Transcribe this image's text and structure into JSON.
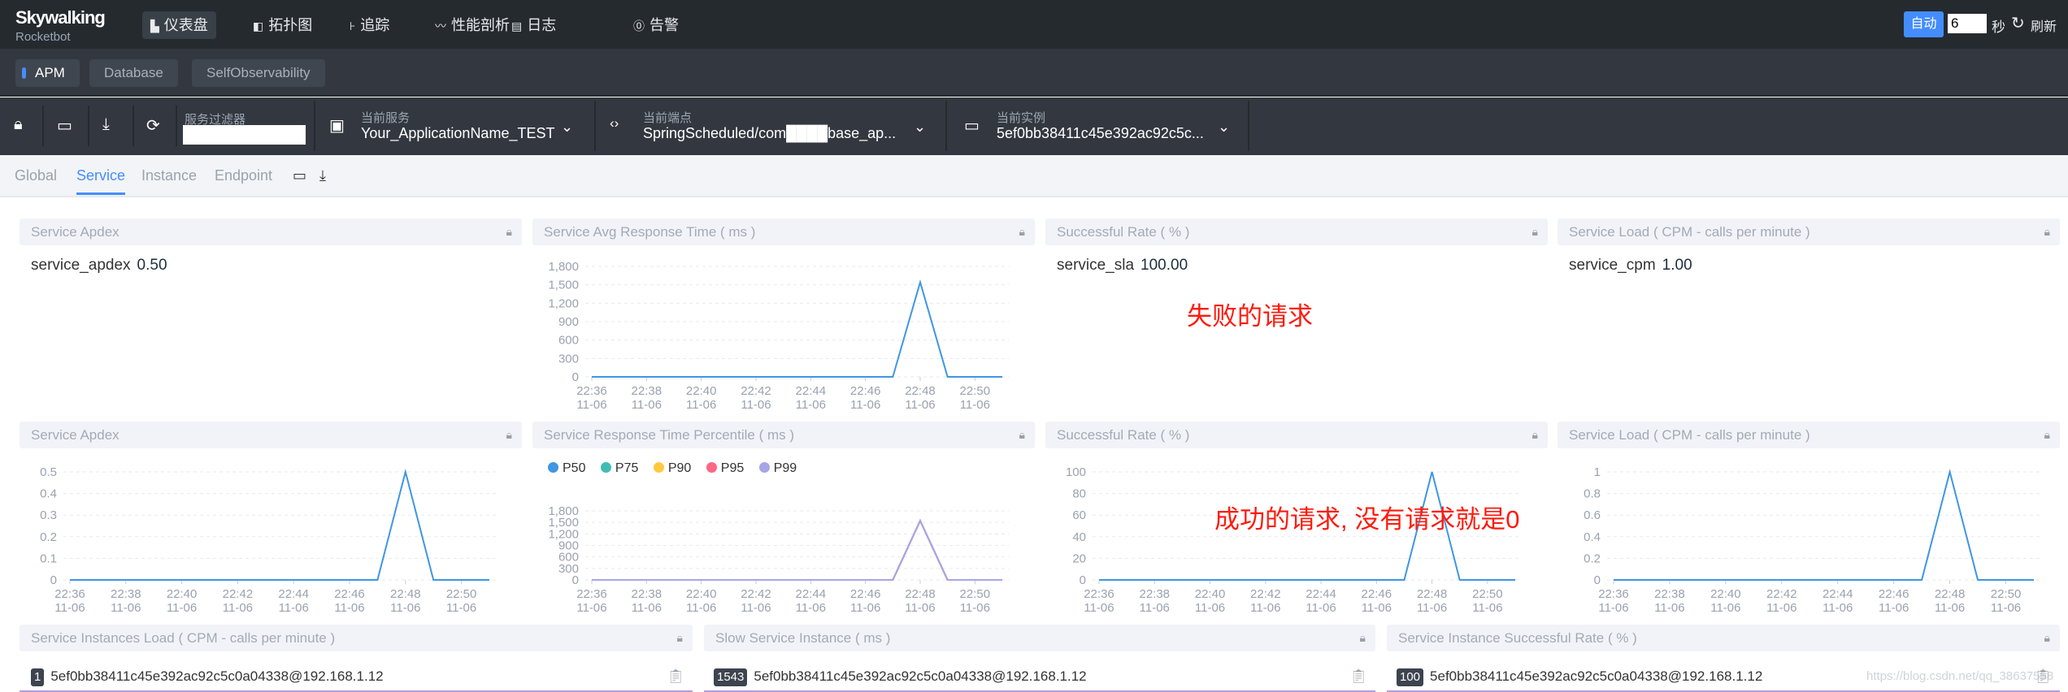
{
  "brand": {
    "name": "Skywalking",
    "sub": "Rocketbot"
  },
  "nav": [
    {
      "label": "仪表盘",
      "icon": "dashboard-icon"
    },
    {
      "label": "拓扑图",
      "icon": "topology-icon"
    },
    {
      "label": "追踪",
      "icon": "trace-icon"
    },
    {
      "label": "性能剖析",
      "icon": "profile-icon"
    },
    {
      "label": "日志",
      "icon": "log-icon"
    },
    {
      "label": "告警",
      "icon": "alarm-icon"
    }
  ],
  "refresh": {
    "auto": "自动",
    "interval": "6",
    "unit": "秒",
    "label": "刷新"
  },
  "groups": [
    "APM",
    "Database",
    "SelfObservability"
  ],
  "toolbar": {
    "filter_label": "服务过滤器",
    "filter_value": "",
    "service_label": "当前服务",
    "service": "Your_ApplicationName_TEST",
    "endpoint_label": "当前端点",
    "endpoint": "SpringScheduled/com████base_ap...",
    "instance_label": "当前实例",
    "instance": "5ef0bb38411c45e392ac92c5c..."
  },
  "tabs": [
    "Global",
    "Service",
    "Instance",
    "Endpoint"
  ],
  "cards": {
    "apdex_value": {
      "title": "Service Apdex",
      "metric": "service_apdex",
      "value": "0.50"
    },
    "avg_rt": {
      "title": "Service Avg Response Time ( ms )"
    },
    "sla_value": {
      "title": "Successful Rate ( % )",
      "metric": "service_sla",
      "value": "100.00"
    },
    "cpm_value": {
      "title": "Service Load ( CPM - calls per minute )",
      "metric": "service_cpm",
      "value": "1.00"
    },
    "apdex_chart": {
      "title": "Service Apdex"
    },
    "percentile": {
      "title": "Service Response Time Percentile ( ms )"
    },
    "sla_chart": {
      "title": "Successful Rate ( % )"
    },
    "cpm_chart": {
      "title": "Service Load ( CPM - calls per minute )"
    },
    "inst_load": {
      "title": "Service Instances Load ( CPM - calls per minute )",
      "items": [
        {
          "badge": "1",
          "name": "5ef0bb38411c45e392ac92c5c0a04338@192.168.1.12",
          "fraction": 1
        }
      ]
    },
    "slow_inst": {
      "title": "Slow Service Instance ( ms )",
      "items": [
        {
          "badge": "1543",
          "name": "5ef0bb38411c45e392ac92c5c0a04338@192.168.1.12",
          "fraction": 1
        }
      ]
    },
    "inst_sla": {
      "title": "Service Instance Successful Rate ( % )",
      "items": [
        {
          "badge": "100",
          "name": "5ef0bb38411c45e392ac92c5c0a04338@192.168.1.12",
          "fraction": 1
        }
      ]
    }
  },
  "annotations": {
    "failed": "失败的请求",
    "success": "成功的请求, 没有请求就是0"
  },
  "watermark": "https://blog.csdn.net/qq_38637558",
  "colors": {
    "accent": "#448dfe",
    "line": "#3f96e3",
    "p50": "#3f96e3",
    "p75": "#3fbdb4",
    "p90": "#ffc940",
    "p95": "#ff6685",
    "p99": "#a6a6e6"
  },
  "chart_data": [
    {
      "id": "avg_rt",
      "type": "line",
      "x": [
        "22:36",
        "22:37",
        "22:38",
        "22:39",
        "22:40",
        "22:41",
        "22:42",
        "22:43",
        "22:44",
        "22:45",
        "22:46",
        "22:47",
        "22:48",
        "22:49",
        "22:50",
        "22:51"
      ],
      "x_sub": "11-06",
      "xticks": [
        "22:36",
        "22:38",
        "22:40",
        "22:42",
        "22:44",
        "22:46",
        "22:48",
        "22:50"
      ],
      "yticks": [
        "0",
        "300",
        "600",
        "900",
        "1,200",
        "1,500",
        "1,800"
      ],
      "ylim": [
        0,
        1800
      ],
      "grid": true,
      "series": [
        {
          "values": [
            0,
            0,
            0,
            0,
            0,
            0,
            0,
            0,
            0,
            0,
            0,
            0,
            1543,
            0,
            0,
            0
          ]
        }
      ]
    },
    {
      "id": "apdex_chart",
      "type": "line",
      "x": [
        "22:36",
        "22:37",
        "22:38",
        "22:39",
        "22:40",
        "22:41",
        "22:42",
        "22:43",
        "22:44",
        "22:45",
        "22:46",
        "22:47",
        "22:48",
        "22:49",
        "22:50",
        "22:51"
      ],
      "x_sub": "11-06",
      "xticks": [
        "22:36",
        "22:38",
        "22:40",
        "22:42",
        "22:44",
        "22:46",
        "22:48",
        "22:50"
      ],
      "yticks": [
        "0",
        "0.1",
        "0.2",
        "0.3",
        "0.4",
        "0.5"
      ],
      "ylim": [
        0,
        0.5
      ],
      "grid": true,
      "series": [
        {
          "values": [
            0,
            0,
            0,
            0,
            0,
            0,
            0,
            0,
            0,
            0,
            0,
            0,
            0.5,
            0,
            0,
            0
          ]
        }
      ]
    },
    {
      "id": "percentile",
      "type": "line",
      "x": [
        "22:36",
        "22:37",
        "22:38",
        "22:39",
        "22:40",
        "22:41",
        "22:42",
        "22:43",
        "22:44",
        "22:45",
        "22:46",
        "22:47",
        "22:48",
        "22:49",
        "22:50",
        "22:51"
      ],
      "x_sub": "11-06",
      "xticks": [
        "22:36",
        "22:38",
        "22:40",
        "22:42",
        "22:44",
        "22:46",
        "22:48",
        "22:50"
      ],
      "yticks": [
        "0",
        "300",
        "600",
        "900",
        "1,200",
        "1,500",
        "1,800"
      ],
      "ylim": [
        0,
        1800
      ],
      "grid": true,
      "legend": "top-left",
      "series": [
        {
          "name": "P50",
          "values": [
            0,
            0,
            0,
            0,
            0,
            0,
            0,
            0,
            0,
            0,
            0,
            0,
            1543,
            0,
            0,
            0
          ]
        },
        {
          "name": "P75",
          "values": [
            0,
            0,
            0,
            0,
            0,
            0,
            0,
            0,
            0,
            0,
            0,
            0,
            1543,
            0,
            0,
            0
          ]
        },
        {
          "name": "P90",
          "values": [
            0,
            0,
            0,
            0,
            0,
            0,
            0,
            0,
            0,
            0,
            0,
            0,
            1543,
            0,
            0,
            0
          ]
        },
        {
          "name": "P95",
          "values": [
            0,
            0,
            0,
            0,
            0,
            0,
            0,
            0,
            0,
            0,
            0,
            0,
            1543,
            0,
            0,
            0
          ]
        },
        {
          "name": "P99",
          "values": [
            0,
            0,
            0,
            0,
            0,
            0,
            0,
            0,
            0,
            0,
            0,
            0,
            1543,
            0,
            0,
            0
          ]
        }
      ]
    },
    {
      "id": "sla_chart",
      "type": "line",
      "x": [
        "22:36",
        "22:37",
        "22:38",
        "22:39",
        "22:40",
        "22:41",
        "22:42",
        "22:43",
        "22:44",
        "22:45",
        "22:46",
        "22:47",
        "22:48",
        "22:49",
        "22:50",
        "22:51"
      ],
      "x_sub": "11-06",
      "xticks": [
        "22:36",
        "22:38",
        "22:40",
        "22:42",
        "22:44",
        "22:46",
        "22:48",
        "22:50"
      ],
      "yticks": [
        "0",
        "20",
        "40",
        "60",
        "80",
        "100"
      ],
      "ylim": [
        0,
        100
      ],
      "grid": true,
      "series": [
        {
          "values": [
            0,
            0,
            0,
            0,
            0,
            0,
            0,
            0,
            0,
            0,
            0,
            0,
            100,
            0,
            0,
            0
          ]
        }
      ]
    },
    {
      "id": "cpm_chart",
      "type": "line",
      "x": [
        "22:36",
        "22:37",
        "22:38",
        "22:39",
        "22:40",
        "22:41",
        "22:42",
        "22:43",
        "22:44",
        "22:45",
        "22:46",
        "22:47",
        "22:48",
        "22:49",
        "22:50",
        "22:51"
      ],
      "x_sub": "11-06",
      "xticks": [
        "22:36",
        "22:38",
        "22:40",
        "22:42",
        "22:44",
        "22:46",
        "22:48",
        "22:50"
      ],
      "yticks": [
        "0",
        "0.2",
        "0.4",
        "0.6",
        "0.8",
        "1"
      ],
      "ylim": [
        0,
        1
      ],
      "grid": true,
      "series": [
        {
          "values": [
            0,
            0,
            0,
            0,
            0,
            0,
            0,
            0,
            0,
            0,
            0,
            0,
            1,
            0,
            0,
            0
          ]
        }
      ]
    }
  ]
}
